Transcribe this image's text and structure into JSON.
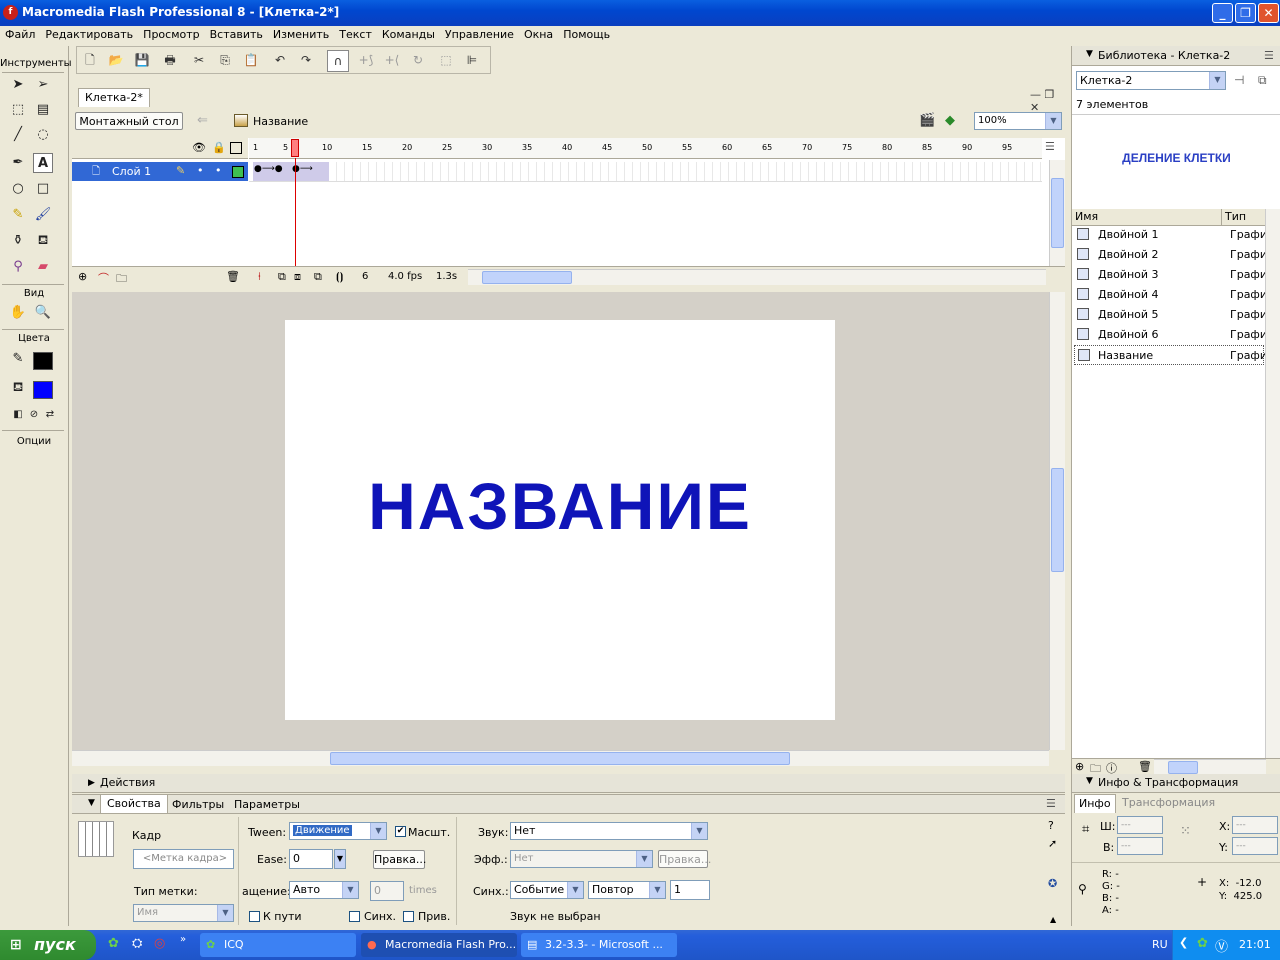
{
  "window": {
    "title": "Macromedia Flash Professional 8 - [Клетка-2*]",
    "app_icon": "flash-f-icon",
    "buttons": [
      "minimize",
      "maximize",
      "close"
    ]
  },
  "menu": [
    "Файл",
    "Редактировать",
    "Просмотр",
    "Вставить",
    "Изменить",
    "Текст",
    "Команды",
    "Управление",
    "Окна",
    "Помощь"
  ],
  "toolbar": {
    "icons": [
      "new-file-icon",
      "open-file-icon",
      "save-icon",
      "print-icon",
      "cut-icon",
      "copy-icon",
      "paste-icon",
      "undo-icon",
      "redo-icon",
      "snap-magnet-icon",
      "smooth-icon",
      "straighten-icon",
      "rotate-icon",
      "scale-icon",
      "align-icon"
    ]
  },
  "tools": {
    "title": "Инструменты",
    "view_label": "Вид",
    "colors_label": "Цвета",
    "options_label": "Опции",
    "stroke_color": "#000000",
    "fill_color": "#0000ff"
  },
  "document": {
    "tab": "Клетка-2*",
    "scene_button": "Монтажный стол",
    "symbol_name": "Название",
    "zoom": "100%",
    "stage_text": "НАЗВАНИЕ",
    "stage_text_color": "#0f14b8"
  },
  "timeline": {
    "ruler": [
      "1",
      "5",
      "10",
      "15",
      "20",
      "25",
      "30",
      "35",
      "40",
      "45",
      "50",
      "55",
      "60",
      "65",
      "70",
      "75",
      "80",
      "85",
      "90",
      "95"
    ],
    "layer_name": "Слой 1",
    "current_frame": "6",
    "fps": "4.0 fps",
    "time": "1.3s"
  },
  "actions_panel": {
    "title": "Действия"
  },
  "properties": {
    "tabs": [
      "Свойства",
      "Фильтры",
      "Параметры"
    ],
    "frame_label": "Кадр",
    "frame_name_placeholder": "<Метка кадра>",
    "label_type": "Тип метки:",
    "label_type_value": "Имя",
    "tween_label": "Tween:",
    "tween_value": "Движение",
    "scale_label": "Масшт.",
    "ease_label": "Ease:",
    "ease_value": "0",
    "edit_button": "Правка...",
    "rotate_label": "ащение:",
    "rotate_value": "Авто",
    "rotate_times_value": "0",
    "times_label": "times",
    "orient_label": "К пути",
    "sync_check_label": "Синх.",
    "snap_label": "Прив.",
    "sound_label": "Звук:",
    "sound_value": "Нет",
    "effect_label": "Эфф.:",
    "effect_value": "Нет",
    "effect_edit": "Правка...",
    "sync_label": "Синх.:",
    "sync_value": "Событие",
    "repeat_value": "Повтор",
    "repeat_count": "1",
    "sound_status": "Звук не выбран"
  },
  "library": {
    "title": "Библиотека - Клетка-2",
    "doc_select": "Клетка-2",
    "count": "7 элементов",
    "preview_text": "ДЕЛЕНИЕ КЛЕТКИ",
    "col_name": "Имя",
    "col_type": "Тип",
    "items": [
      {
        "name": "Двойной 1",
        "type": "Графи"
      },
      {
        "name": "Двойной 2",
        "type": "Графи"
      },
      {
        "name": "Двойной 3",
        "type": "Графи"
      },
      {
        "name": "Двойной 4",
        "type": "Графи"
      },
      {
        "name": "Двойной 5",
        "type": "Графи"
      },
      {
        "name": "Двойной 6",
        "type": "Графи"
      },
      {
        "name": "Название",
        "type": "Графи"
      }
    ]
  },
  "info": {
    "title": "Инфо & Трансформация",
    "tabs": [
      "Инфо",
      "Трансформация"
    ],
    "w_label": "Ш:",
    "w_value": "---",
    "h_label": "В:",
    "h_value": "---",
    "x_label": "X:",
    "x_value": "---",
    "y_label": "Y:",
    "y_value": "---",
    "r": "R: -",
    "g": "G: -",
    "b": "B: -",
    "a": "A: -",
    "cursor_x": "X:  -12.0",
    "cursor_y": "Y:  425.0"
  },
  "taskbar": {
    "start": "пуск",
    "tasks": [
      "ICQ",
      "Macromedia Flash Pro...",
      "3.2-3.3- - Microsoft ..."
    ],
    "lang": "RU",
    "clock": "21:01"
  }
}
